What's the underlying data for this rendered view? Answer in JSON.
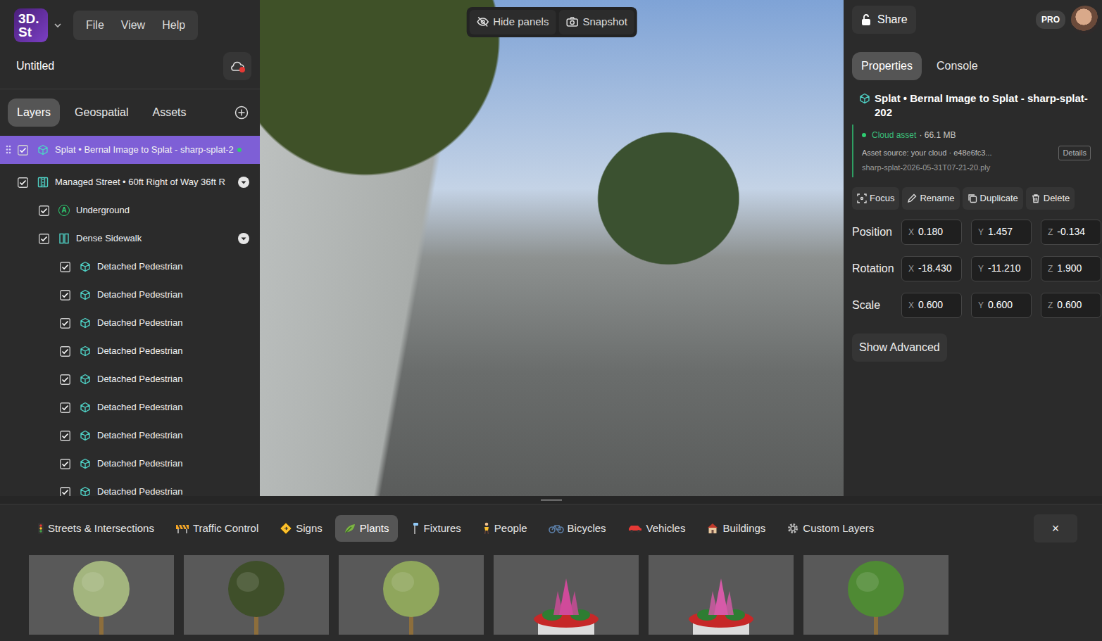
{
  "app": {
    "logo": [
      "3D.",
      "St"
    ],
    "menu": [
      "File",
      "View",
      "Help"
    ],
    "project_title": "Untitled"
  },
  "left_tabs": [
    {
      "label": "Layers",
      "selected": true
    },
    {
      "label": "Geospatial",
      "selected": false
    },
    {
      "label": "Assets",
      "selected": false
    }
  ],
  "layers": [
    {
      "label": "Splat • Bernal Image to Splat - sharp-splat-2",
      "kind": "splat",
      "depth": 0,
      "checked": true,
      "selected": true,
      "expanded": false,
      "synced": true
    },
    {
      "label": "Managed Street • 60ft Right of Way 36ft R",
      "kind": "street",
      "depth": 0,
      "checked": true,
      "selected": false,
      "expanded": true,
      "synced": false
    },
    {
      "label": "Underground",
      "kind": "badge",
      "badge": "A",
      "depth": 1,
      "checked": true,
      "selected": false,
      "expanded": false,
      "synced": false
    },
    {
      "label": "Dense Sidewalk",
      "kind": "segment",
      "depth": 1,
      "checked": true,
      "selected": false,
      "expanded": true,
      "synced": false
    },
    {
      "label": "Detached Pedestrian",
      "kind": "entity",
      "depth": 2,
      "checked": true,
      "selected": false,
      "expanded": false,
      "synced": false
    },
    {
      "label": "Detached Pedestrian",
      "kind": "entity",
      "depth": 2,
      "checked": true,
      "selected": false,
      "expanded": false,
      "synced": false
    },
    {
      "label": "Detached Pedestrian",
      "kind": "entity",
      "depth": 2,
      "checked": true,
      "selected": false,
      "expanded": false,
      "synced": false
    },
    {
      "label": "Detached Pedestrian",
      "kind": "entity",
      "depth": 2,
      "checked": true,
      "selected": false,
      "expanded": false,
      "synced": false
    },
    {
      "label": "Detached Pedestrian",
      "kind": "entity",
      "depth": 2,
      "checked": true,
      "selected": false,
      "expanded": false,
      "synced": false
    },
    {
      "label": "Detached Pedestrian",
      "kind": "entity",
      "depth": 2,
      "checked": true,
      "selected": false,
      "expanded": false,
      "synced": false
    },
    {
      "label": "Detached Pedestrian",
      "kind": "entity",
      "depth": 2,
      "checked": true,
      "selected": false,
      "expanded": false,
      "synced": false
    },
    {
      "label": "Detached Pedestrian",
      "kind": "entity",
      "depth": 2,
      "checked": true,
      "selected": false,
      "expanded": false,
      "synced": false
    },
    {
      "label": "Detached Pedestrian",
      "kind": "entity",
      "depth": 2,
      "checked": true,
      "selected": false,
      "expanded": false,
      "synced": false
    }
  ],
  "viewport": {
    "toolbar": [
      "Hide panels",
      "Snapshot"
    ]
  },
  "header": {
    "share": "Share",
    "plan": "PRO"
  },
  "right_tabs": [
    {
      "label": "Properties",
      "selected": true
    },
    {
      "label": "Console",
      "selected": false
    }
  ],
  "selection": {
    "title": "Splat • Bernal Image to Splat - sharp-splat-202",
    "asset": {
      "status": "Cloud asset",
      "size": "· 66.1 MB",
      "source": "Asset source: your cloud · e48e6fc3...",
      "details": "Details",
      "file": "sharp-splat-2026-05-31T07-21-20.ply"
    },
    "actions": [
      "Focus",
      "Rename",
      "Duplicate",
      "Delete"
    ],
    "transforms": [
      {
        "label": "Position",
        "values": [
          {
            "axis": "X",
            "value": "0.180"
          },
          {
            "axis": "Y",
            "value": "1.457"
          },
          {
            "axis": "Z",
            "value": "-0.134"
          }
        ]
      },
      {
        "label": "Rotation",
        "values": [
          {
            "axis": "X",
            "value": "-18.430"
          },
          {
            "axis": "Y",
            "value": "-11.210"
          },
          {
            "axis": "Z",
            "value": "1.900"
          }
        ]
      },
      {
        "label": "Scale",
        "values": [
          {
            "axis": "X",
            "value": "0.600"
          },
          {
            "axis": "Y",
            "value": "0.600"
          },
          {
            "axis": "Z",
            "value": "0.600"
          }
        ]
      }
    ],
    "advanced": "Show Advanced"
  },
  "library": {
    "categories": [
      {
        "label": "Streets & Intersections",
        "selected": false
      },
      {
        "label": "Traffic Control",
        "selected": false
      },
      {
        "label": "Signs",
        "selected": false
      },
      {
        "label": "Plants",
        "selected": true
      },
      {
        "label": "Fixtures",
        "selected": false
      },
      {
        "label": "People",
        "selected": false
      },
      {
        "label": "Bicycles",
        "selected": false
      },
      {
        "label": "Vehicles",
        "selected": false
      },
      {
        "label": "Buildings",
        "selected": false
      },
      {
        "label": "Custom Layers",
        "selected": false
      }
    ],
    "close": "×",
    "items": [
      {
        "kind": "tree",
        "color": "#a3b57e"
      },
      {
        "kind": "tree",
        "color": "#3f4f2a"
      },
      {
        "kind": "tree",
        "color": "#8fa65c"
      },
      {
        "kind": "planter",
        "color": "#d04a9a"
      },
      {
        "kind": "planter",
        "color": "#d65aa8"
      },
      {
        "kind": "tree",
        "color": "#4f8a34"
      }
    ]
  }
}
